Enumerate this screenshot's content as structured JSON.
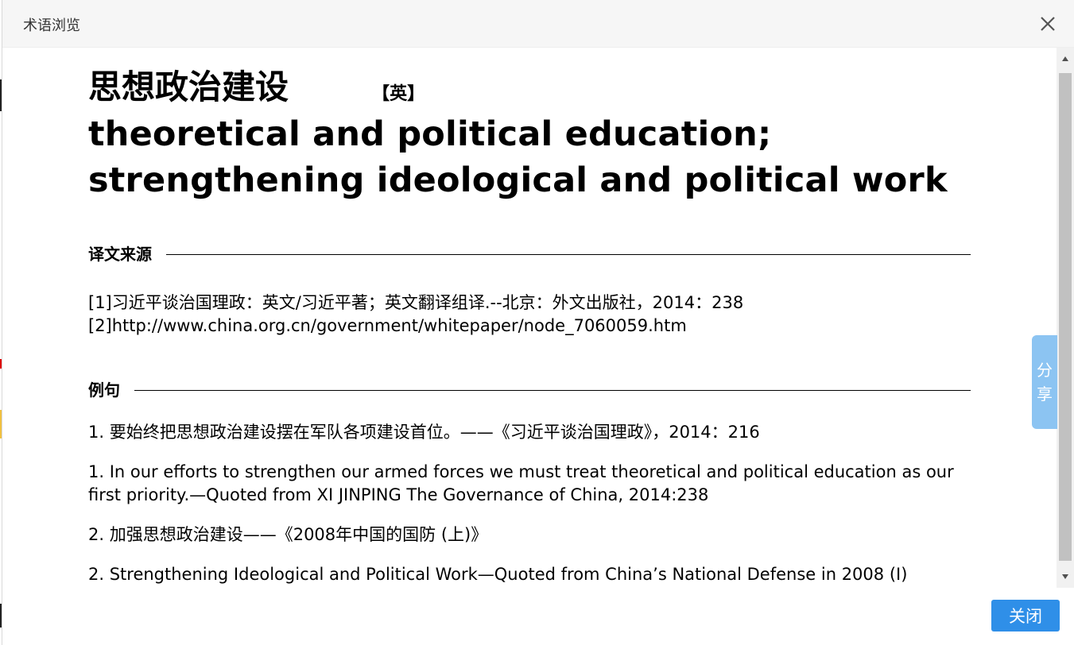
{
  "window": {
    "title": "术语浏览",
    "close_icon": "close-icon"
  },
  "term": {
    "zh": "思想政治建设",
    "lang_tag": "【英】",
    "en": "theoretical and political education; strengthening ideological and political work"
  },
  "sources_section": {
    "title": "译文来源",
    "items": [
      "[1]习近平谈治国理政：英文/习近平著；英文翻译组译.--北京：外文出版社，2014：238",
      "[2]http://www.china.org.cn/government/whitepaper/node_7060059.htm"
    ]
  },
  "examples_section": {
    "title": "例句",
    "items": [
      "1. 要始终把思想政治建设摆在军队各项建设首位。——《习近平谈治国理政》，2014：216",
      "1. In our efforts to strengthen our armed forces we must treat theoretical and political education as our first priority.—Quoted from XI JINPING The Governance of China, 2014:238",
      "2. 加强思想政治建设——《2008年中国的国防 (上)》",
      "2. Strengthening Ideological and Political Work—Quoted from China’s National Defense in 2008 (I)"
    ]
  },
  "share_tab": {
    "line1": "分",
    "line2": "享"
  },
  "footer": {
    "close_label": "关闭"
  },
  "colors": {
    "primary_button": "#2f8fe8",
    "share_tab": "#8cc4f2",
    "titlebar": "#f6f6f6"
  }
}
